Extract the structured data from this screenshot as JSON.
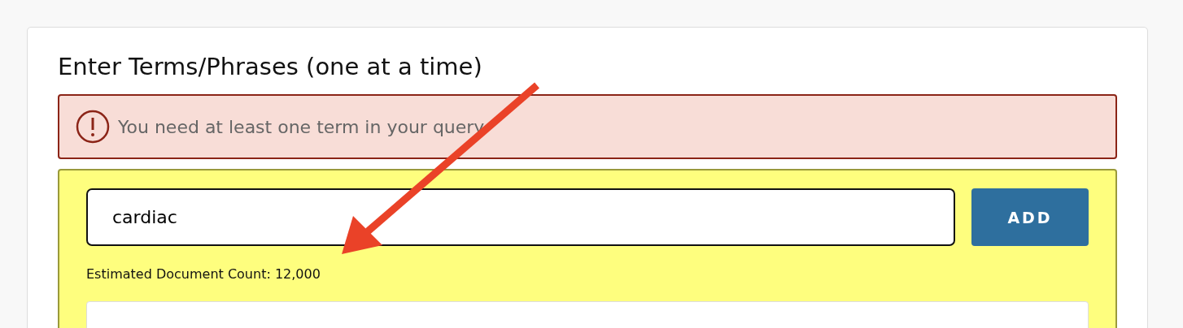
{
  "heading": "Enter Terms/Phrases (one at a time)",
  "alert": {
    "message": "You need at least one term in your query"
  },
  "term_entry": {
    "value": "cardiac",
    "button": "ADD",
    "estimate": "Estimated Document Count: 12,000"
  }
}
